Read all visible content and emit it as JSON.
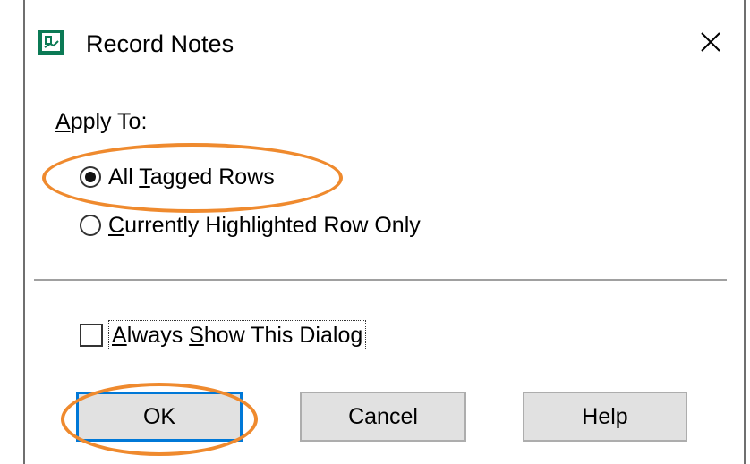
{
  "window": {
    "title": "Record Notes",
    "close_glyph": "✕"
  },
  "apply_to": {
    "label": "Apply To:",
    "options": [
      {
        "label": "All Tagged Rows",
        "selected": true
      },
      {
        "label": "Currently Highlighted Row Only",
        "selected": false
      }
    ]
  },
  "always_show": {
    "label": "Always Show This Dialog",
    "checked": false
  },
  "buttons": {
    "ok": "OK",
    "cancel": "Cancel",
    "help": "Help"
  },
  "colors": {
    "highlight": "#ef8a2e",
    "focus_border": "#0078d7",
    "icon": "#0b7a55"
  }
}
